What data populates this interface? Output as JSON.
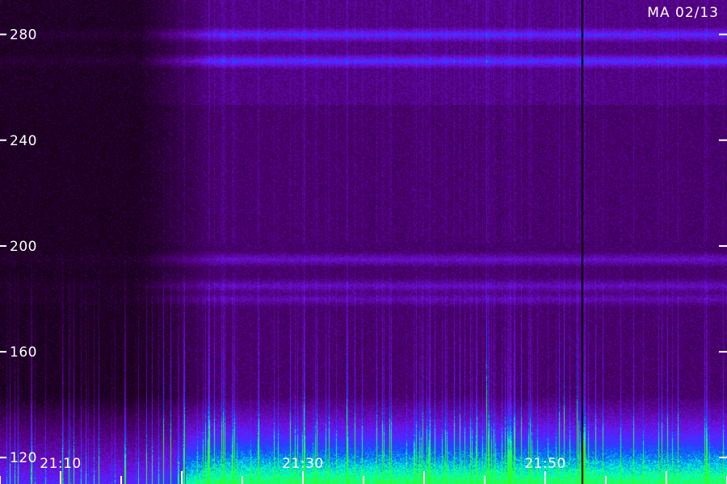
{
  "station_label": "MA 02/13",
  "colors": {
    "background": "#000000",
    "low": "#3a0a5c",
    "mid": "#6a1fa8",
    "high": "#1a2cff",
    "peak": "#00ffd0",
    "max": "#30ff30",
    "axis_text": "#ffffff"
  },
  "chart_data": {
    "type": "heatmap",
    "title": "",
    "xlabel": "",
    "ylabel": "",
    "y_ticks": [
      120,
      160,
      200,
      240,
      280
    ],
    "y_tick_labels": [
      "120",
      "160",
      "200",
      "240",
      "280"
    ],
    "ylim": [
      110,
      293
    ],
    "x_ticks": [
      "21:10",
      "21:30",
      "21:50"
    ],
    "xlim_minutes_after_21": [
      5,
      65
    ],
    "x_minor_step_minutes": 5,
    "bands": [
      {
        "freq": 280,
        "intensity": 0.85
      },
      {
        "freq": 270,
        "intensity": 0.9
      },
      {
        "freq": 195,
        "intensity": 0.6
      },
      {
        "freq": 185,
        "intensity": 0.55
      },
      {
        "freq": 180,
        "intensity": 0.45
      }
    ],
    "marker_line_time": "21:53",
    "grid": false,
    "legend": "none"
  }
}
